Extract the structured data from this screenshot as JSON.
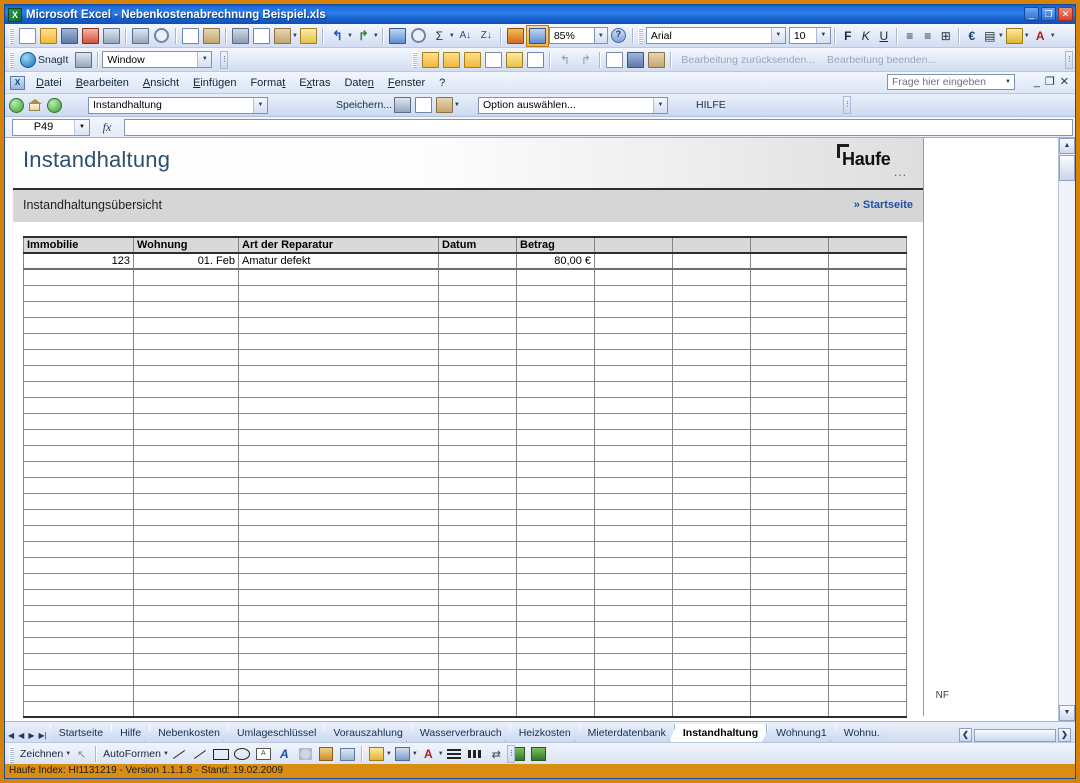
{
  "window": {
    "title": "Microsoft Excel - Nebenkostenabrechnung Beispiel.xls",
    "app_icon": "excel-icon",
    "minimize": "_",
    "restore": "❐",
    "close": "✕"
  },
  "standard_toolbar": {
    "buttons": [
      {
        "name": "new-document",
        "icon": "new-doc-icon"
      },
      {
        "name": "open",
        "icon": "open-folder-icon"
      },
      {
        "name": "save",
        "icon": "save-disk-icon"
      },
      {
        "name": "email",
        "icon": "mail-icon"
      },
      {
        "name": "permission",
        "icon": "permission-icon"
      },
      {
        "name": "print",
        "icon": "printer-icon"
      },
      {
        "name": "print-preview",
        "icon": "print-preview-icon"
      },
      {
        "name": "spelling",
        "icon": "spellcheck-icon"
      },
      {
        "name": "research",
        "icon": "research-icon"
      },
      {
        "name": "cut",
        "icon": "scissors-icon"
      },
      {
        "name": "copy",
        "icon": "copy-icon"
      },
      {
        "name": "paste",
        "icon": "paste-icon"
      },
      {
        "name": "format-painter",
        "icon": "format-painter-icon"
      },
      {
        "name": "undo",
        "icon": "undo-icon"
      },
      {
        "name": "redo",
        "icon": "redo-icon"
      },
      {
        "name": "insert-hyperlink",
        "icon": "hyperlink-icon"
      },
      {
        "name": "autosum",
        "icon": "sigma-icon"
      },
      {
        "name": "sort-ascending",
        "icon": "sort-az-icon"
      },
      {
        "name": "sort-descending",
        "icon": "sort-za-icon"
      },
      {
        "name": "chart-wizard",
        "icon": "chart-icon"
      },
      {
        "name": "drawing",
        "icon": "drawing-icon"
      }
    ],
    "zoom": "85%",
    "help_icon": "help-icon"
  },
  "formatting_toolbar": {
    "font_name": "Arial",
    "font_size": "10",
    "bold": "F",
    "italic": "K",
    "underline": "U",
    "align_left": "align-left",
    "align_center": "align-center",
    "merge_center": "merge-center",
    "currency": "€",
    "borders": "borders",
    "fill_color": "fill-color",
    "font_color": "font-color"
  },
  "review_toolbar": {
    "send_for_review": "Bearbeitung zurücksenden...",
    "end_review": "Bearbeitung beenden..."
  },
  "snagit_toolbar": {
    "label": "SnagIt",
    "profile": "Window"
  },
  "menu": {
    "app_icon": "excel-small-icon",
    "items": [
      {
        "label": "Datei",
        "accel": "D"
      },
      {
        "label": "Bearbeiten",
        "accel": "B"
      },
      {
        "label": "Ansicht",
        "accel": "A"
      },
      {
        "label": "Einfügen",
        "accel": "E"
      },
      {
        "label": "Format",
        "accel": "t"
      },
      {
        "label": "Extras",
        "accel": "x"
      },
      {
        "label": "Daten",
        "accel": "n"
      },
      {
        "label": "Fenster",
        "accel": "F"
      },
      {
        "label": "?",
        "accel": "?"
      }
    ],
    "ask_placeholder": "Frage hier eingeben"
  },
  "haufe_toolbar": {
    "back_icon": "back-arrow-icon",
    "home_icon": "home-icon",
    "forward_icon": "forward-arrow-icon",
    "sheet_select": "Instandhaltung",
    "save_label": "Speichern...",
    "option_select": "Option auswählen...",
    "help_label": "HILFE"
  },
  "formula_bar": {
    "name_box": "P49",
    "fx": "fx",
    "formula": ""
  },
  "page": {
    "title": "Instandhaltung",
    "logo_word": "Haufe",
    "logo_dots": "...",
    "subtitle": "Instandhaltungsübersicht",
    "start_link": "» Startseite"
  },
  "table": {
    "headers": [
      "Immobilie",
      "Wohnung",
      "Art der Reparatur",
      "Datum",
      "Betrag",
      "",
      "",
      "",
      ""
    ],
    "rows": [
      [
        "123",
        "01. Feb",
        "Amatur defekt",
        "",
        "80,00 €",
        "",
        "",
        "",
        ""
      ]
    ],
    "empty_row_count": 28
  },
  "sheet_tabs": {
    "nav": [
      "|◀",
      "◀",
      "▶",
      "▶|"
    ],
    "items": [
      {
        "label": "Startseite",
        "active": false
      },
      {
        "label": "Hilfe",
        "active": false
      },
      {
        "label": "Nebenkosten",
        "active": false
      },
      {
        "label": "Umlageschlüssel",
        "active": false
      },
      {
        "label": "Vorauszahlung",
        "active": false
      },
      {
        "label": "Wasserverbrauch",
        "active": false
      },
      {
        "label": "Heizkosten",
        "active": false
      },
      {
        "label": "Mieterdatenbank",
        "active": false
      },
      {
        "label": "Instandhaltung",
        "active": true
      },
      {
        "label": "Wohnung1",
        "active": false
      },
      {
        "label": "Wohnu.",
        "active": false
      }
    ],
    "scroll_left": "❮",
    "scroll_right": "❯"
  },
  "drawing_toolbar": {
    "draw_label": "Zeichnen",
    "select_icon": "select-arrow-icon",
    "autoshapes_label": "AutoFormen",
    "tools": [
      {
        "name": "line-tool",
        "icon": "line-icon"
      },
      {
        "name": "arrow-tool",
        "icon": "arrow-icon"
      },
      {
        "name": "rectangle-tool",
        "icon": "rectangle-icon"
      },
      {
        "name": "oval-tool",
        "icon": "oval-icon"
      },
      {
        "name": "textbox-tool",
        "icon": "textbox-icon"
      },
      {
        "name": "wordart-tool",
        "icon": "wordart-icon"
      },
      {
        "name": "diagram-tool",
        "icon": "diagram-icon"
      },
      {
        "name": "clipart-tool",
        "icon": "clipart-icon"
      },
      {
        "name": "picture-tool",
        "icon": "picture-icon"
      },
      {
        "name": "fill-color-tool",
        "icon": "fill-color-icon"
      },
      {
        "name": "line-color-tool",
        "icon": "line-color-icon"
      },
      {
        "name": "font-color-tool",
        "icon": "font-color-icon"
      },
      {
        "name": "line-style-tool",
        "icon": "line-style-icon"
      },
      {
        "name": "dash-style-tool",
        "icon": "dash-style-icon"
      },
      {
        "name": "arrow-style-tool",
        "icon": "arrow-style-icon"
      },
      {
        "name": "shadow-style-tool",
        "icon": "shadow-icon"
      },
      {
        "name": "3d-style-tool",
        "icon": "3d-icon"
      }
    ]
  },
  "status_bar": {
    "text": "Haufe Index: HI1131219 - Version 1.1.1.8 - Stand: 19.02.2009",
    "mode": "NF"
  },
  "colors": {
    "window_frame": "#d9820a",
    "title_blue": "#1f6fe0",
    "accent_link": "#1f4fa8",
    "page_title": "#2e4f70",
    "grey_band": "#d6d6d6",
    "header_cell": "#d9d9d9",
    "status_orange": "#d98d12"
  }
}
